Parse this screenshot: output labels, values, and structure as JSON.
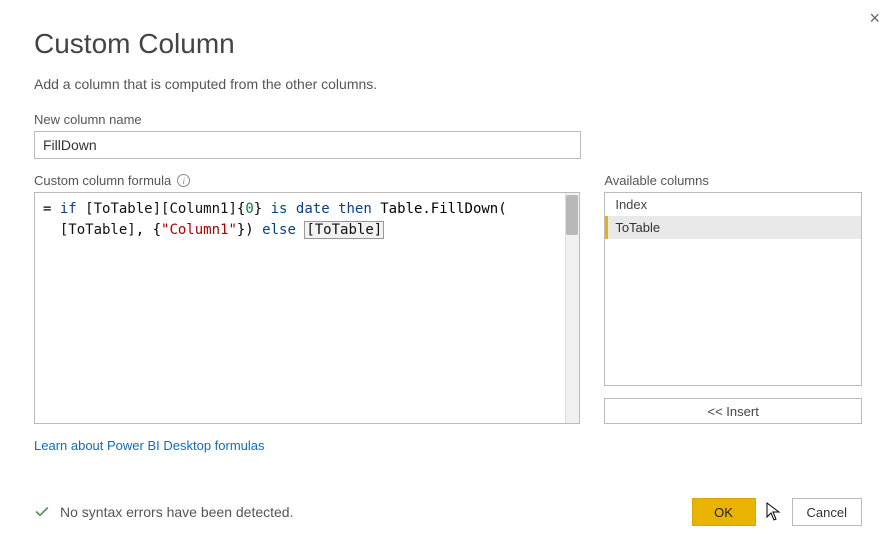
{
  "dialog": {
    "title": "Custom Column",
    "subtitle": "Add a column that is computed from the other columns.",
    "close_icon": "×"
  },
  "name_field": {
    "label": "New column name",
    "value": "FillDown"
  },
  "formula": {
    "label": "Custom column formula",
    "info_symbol": "i",
    "tokens": {
      "eq": "= ",
      "if": "if",
      "sp": " ",
      "ref1": "[ToTable][Column1]",
      "brace_open": "{",
      "zero": "0",
      "brace_close": "}",
      "is": "is",
      "date": "date",
      "then": "then",
      "fn": " Table.FillDown(",
      "nl_indent": "\n  ",
      "ref2": "[ToTable]",
      "comma": ", {",
      "str1": "\"Column1\"",
      "close1": "}) ",
      "else": "else",
      "ref3": "[ToTable]"
    }
  },
  "available": {
    "label": "Available columns",
    "items": [
      "Index",
      "ToTable"
    ],
    "selected_index": 1,
    "insert_label": "<< Insert"
  },
  "link": {
    "text": "Learn about Power BI Desktop formulas"
  },
  "status": {
    "text": "No syntax errors have been detected."
  },
  "buttons": {
    "ok": "OK",
    "cancel": "Cancel"
  }
}
